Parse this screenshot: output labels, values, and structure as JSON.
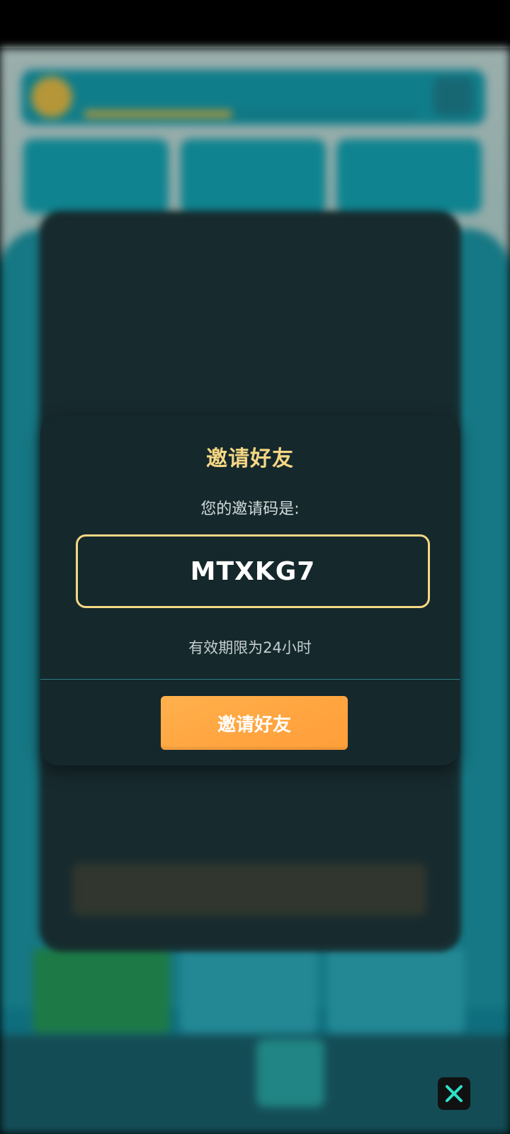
{
  "dialog": {
    "title": "邀请好友",
    "subtitle": "您的邀请码是:",
    "invite_code": "MTXKG7",
    "expiry_text": "有效期限为24小时",
    "button_label": "邀请好友"
  },
  "colors": {
    "accent": "#F6D784",
    "button": "#FFA640",
    "dialog_bg": "#15282C",
    "close_icon": "#2EE1C8"
  },
  "icons": {
    "close": "close-icon"
  }
}
